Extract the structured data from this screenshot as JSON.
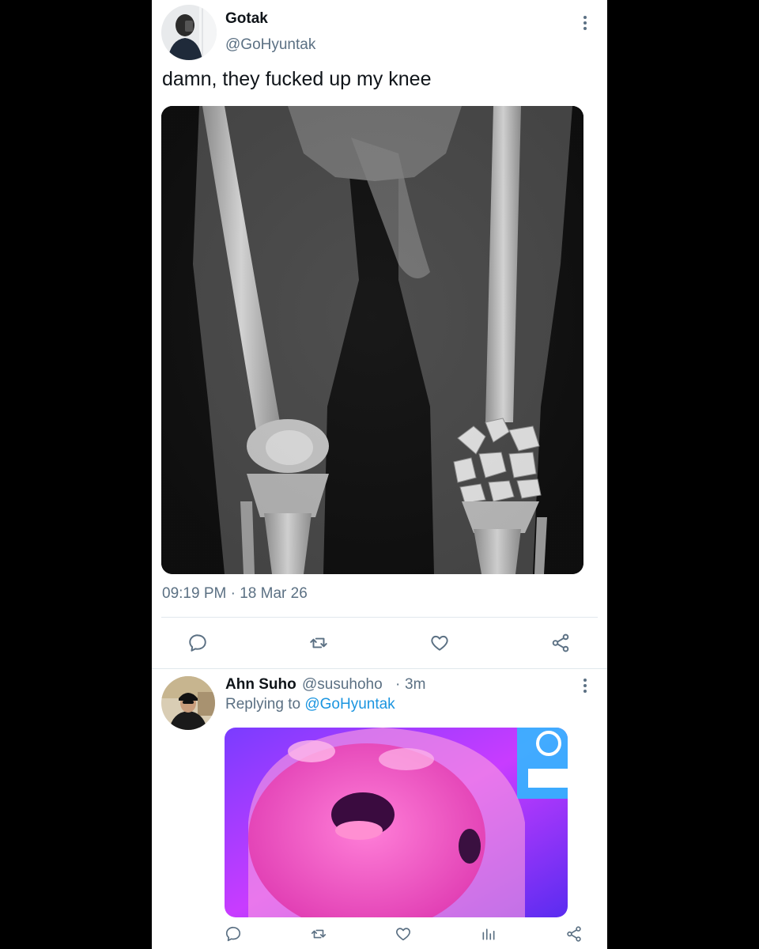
{
  "tweet": {
    "author_name": "Gotak",
    "author_handle": "@GoHyuntak",
    "text": "damn, they fucked up my knee",
    "timestamp": "09:19 PM · 18 Mar 26",
    "more_icon": "more-vertical-icon",
    "actions": [
      "reply-icon",
      "retweet-icon",
      "like-icon",
      "share-icon"
    ]
  },
  "reply": {
    "author_name": "Ahn Suho",
    "author_handle": "@susuhoho",
    "separator": "·",
    "time": "3m",
    "replying_prefix": "Replying to ",
    "replying_handle": "@GoHyuntak",
    "more_icon": "more-vertical-icon",
    "actions": [
      "reply-icon",
      "retweet-icon",
      "like-icon",
      "analytics-icon",
      "share-icon"
    ]
  },
  "colors": {
    "background": "#000000",
    "panel": "#ffffff",
    "text": "#0f1419",
    "secondary": "#5b7083",
    "link": "#1b95e0",
    "divider": "#e1e8ed"
  }
}
